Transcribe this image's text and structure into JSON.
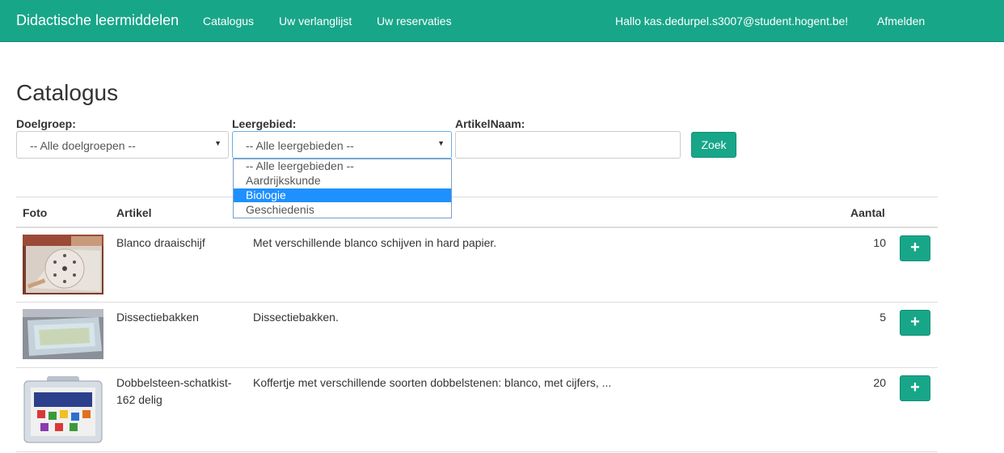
{
  "navbar": {
    "brand": "Didactische leermiddelen",
    "links": [
      "Catalogus",
      "Uw verlanglijst",
      "Uw reservaties"
    ],
    "greeting": "Hallo kas.dedurpel.s3007@student.hogent.be!",
    "logout": "Afmelden"
  },
  "page": {
    "title": "Catalogus"
  },
  "filters": {
    "doelgroep_label": "Doelgroep:",
    "doelgroep_value": "-- Alle doelgroepen --",
    "leergebied_label": "Leergebied:",
    "leergebied_value": "-- Alle leergebieden --",
    "leergebied_options": [
      "-- Alle leergebieden --",
      "Aardrijkskunde",
      "Biologie",
      "Geschiedenis"
    ],
    "leergebied_highlighted": "Biologie",
    "artikelnaam_label": "ArtikelNaam:",
    "artikelnaam_value": "",
    "search_button": "Zoek"
  },
  "table": {
    "headers": {
      "foto": "Foto",
      "artikel": "Artikel",
      "aantal": "Aantal"
    },
    "rows": [
      {
        "name": "Blanco draaischijf",
        "description": "Met verschillende blanco schijven in hard papier.",
        "count": "10"
      },
      {
        "name": "Dissectiebakken",
        "description": "Dissectiebakken.",
        "count": "5"
      },
      {
        "name": "Dobbelsteen-schatkist-162 delig",
        "description": "Koffertje met verschillende soorten dobbelstenen: blanco, met cijfers, ...",
        "count": "20"
      }
    ],
    "add_button_symbol": "+"
  },
  "colors": {
    "brand": "#18a689",
    "selected_option": "#1e90ff"
  }
}
